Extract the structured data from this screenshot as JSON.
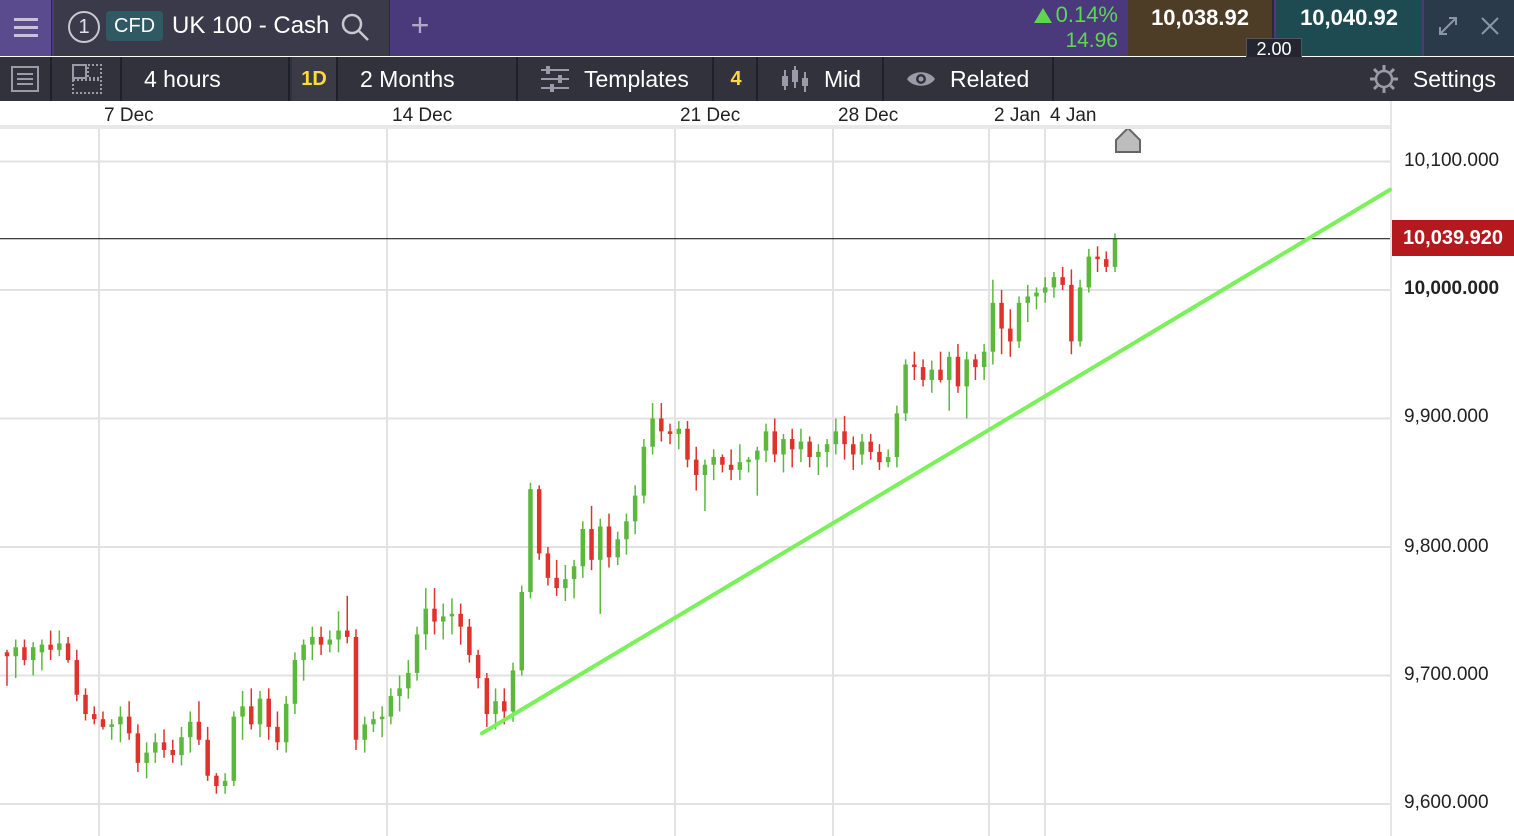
{
  "topbar": {
    "instrument_number": "1",
    "instrument_type": "CFD",
    "instrument_name": "UK 100 - Cash",
    "change_pct": "0.14%",
    "change_abs": "14.96",
    "sell_price": "10,038.92",
    "buy_price": "10,040.92",
    "spread": "2.00",
    "icons": [
      "menu-icon",
      "search-icon",
      "plus-icon",
      "triangle-up-icon",
      "expand-icon",
      "close-icon"
    ]
  },
  "toolbar": {
    "interval": "4 hours",
    "interval_badge": "1D",
    "range": "2 Months",
    "templates": "Templates",
    "templates_count": "4",
    "price_mode": "Mid",
    "related": "Related",
    "settings": "Settings",
    "icons": [
      "list-icon",
      "layout-icon",
      "sliders-icon",
      "candlestick-icon",
      "eye-icon",
      "gear-icon"
    ]
  },
  "chart": {
    "current_price": "10,039.920",
    "date_labels": [
      "7 Dec",
      "14 Dec",
      "21 Dec",
      "28 Dec",
      "2 Jan",
      "4 Jan"
    ],
    "price_labels": [
      "10,100.000",
      "10,000.000",
      "9,900.000",
      "9,800.000",
      "9,700.000",
      "9,600.000"
    ],
    "colors": {
      "up": "#5cb83c",
      "down": "#e0322c",
      "trendline": "#7af05a",
      "current_tag": "#b3191d"
    }
  },
  "chart_data": {
    "type": "candlestick",
    "ylim": [
      9580,
      10140
    ],
    "date_labels": [
      "7 Dec",
      "14 Dec",
      "21 Dec",
      "28 Dec",
      "2 Jan",
      "4 Jan"
    ],
    "y_ticks": [
      10100,
      10000,
      9900,
      9800,
      9700,
      9600
    ],
    "current_price": 10039.92,
    "trendline": {
      "from": 9655,
      "to": 10078
    },
    "candles": [
      [
        9718,
        9720,
        9692,
        9715
      ],
      [
        9715,
        9728,
        9698,
        9722
      ],
      [
        9722,
        9728,
        9708,
        9712
      ],
      [
        9712,
        9726,
        9700,
        9722
      ],
      [
        9718,
        9728,
        9704,
        9724
      ],
      [
        9724,
        9735,
        9712,
        9720
      ],
      [
        9720,
        9735,
        9715,
        9725
      ],
      [
        9725,
        9730,
        9710,
        9712
      ],
      [
        9712,
        9720,
        9680,
        9685
      ],
      [
        9685,
        9690,
        9665,
        9670
      ],
      [
        9670,
        9676,
        9662,
        9666
      ],
      [
        9666,
        9672,
        9658,
        9660
      ],
      [
        9660,
        9666,
        9650,
        9662
      ],
      [
        9662,
        9676,
        9648,
        9668
      ],
      [
        9668,
        9680,
        9650,
        9655
      ],
      [
        9655,
        9662,
        9625,
        9632
      ],
      [
        9632,
        9648,
        9620,
        9640
      ],
      [
        9640,
        9655,
        9632,
        9648
      ],
      [
        9648,
        9658,
        9636,
        9642
      ],
      [
        9642,
        9650,
        9632,
        9638
      ],
      [
        9638,
        9660,
        9630,
        9652
      ],
      [
        9652,
        9672,
        9640,
        9664
      ],
      [
        9664,
        9680,
        9646,
        9650
      ],
      [
        9650,
        9660,
        9618,
        9622
      ],
      [
        9622,
        9624,
        9608,
        9614
      ],
      [
        9614,
        9624,
        9608,
        9618
      ],
      [
        9618,
        9672,
        9614,
        9668
      ],
      [
        9668,
        9688,
        9650,
        9676
      ],
      [
        9676,
        9690,
        9658,
        9662
      ],
      [
        9662,
        9688,
        9652,
        9682
      ],
      [
        9682,
        9690,
        9650,
        9660
      ],
      [
        9660,
        9672,
        9642,
        9648
      ],
      [
        9648,
        9684,
        9640,
        9678
      ],
      [
        9678,
        9718,
        9670,
        9712
      ],
      [
        9712,
        9728,
        9696,
        9724
      ],
      [
        9724,
        9738,
        9712,
        9730
      ],
      [
        9730,
        9738,
        9716,
        9724
      ],
      [
        9724,
        9735,
        9718,
        9728
      ],
      [
        9728,
        9750,
        9718,
        9735
      ],
      [
        9735,
        9762,
        9725,
        9730
      ],
      [
        9730,
        9736,
        9642,
        9650
      ],
      [
        9650,
        9668,
        9640,
        9662
      ],
      [
        9662,
        9672,
        9656,
        9666
      ],
      [
        9666,
        9676,
        9652,
        9668
      ],
      [
        9668,
        9690,
        9662,
        9684
      ],
      [
        9684,
        9700,
        9672,
        9690
      ],
      [
        9690,
        9712,
        9682,
        9702
      ],
      [
        9702,
        9738,
        9696,
        9732
      ],
      [
        9732,
        9768,
        9720,
        9752
      ],
      [
        9752,
        9768,
        9732,
        9742
      ],
      [
        9742,
        9756,
        9728,
        9746
      ],
      [
        9746,
        9760,
        9732,
        9748
      ],
      [
        9748,
        9756,
        9724,
        9738
      ],
      [
        9738,
        9744,
        9710,
        9716
      ],
      [
        9716,
        9720,
        9690,
        9698
      ],
      [
        9698,
        9702,
        9660,
        9670
      ],
      [
        9670,
        9690,
        9658,
        9680
      ],
      [
        9680,
        9690,
        9662,
        9672
      ],
      [
        9672,
        9710,
        9664,
        9704
      ],
      [
        9704,
        9770,
        9700,
        9765
      ],
      [
        9765,
        9850,
        9760,
        9845
      ],
      [
        9845,
        9848,
        9790,
        9795
      ],
      [
        9795,
        9800,
        9770,
        9776
      ],
      [
        9776,
        9790,
        9762,
        9768
      ],
      [
        9768,
        9786,
        9758,
        9775
      ],
      [
        9775,
        9790,
        9760,
        9785
      ],
      [
        9785,
        9820,
        9776,
        9814
      ],
      [
        9814,
        9832,
        9782,
        9790
      ],
      [
        9790,
        9822,
        9748,
        9816
      ],
      [
        9816,
        9826,
        9784,
        9792
      ],
      [
        9792,
        9812,
        9786,
        9806
      ],
      [
        9806,
        9826,
        9794,
        9820
      ],
      [
        9820,
        9848,
        9810,
        9840
      ],
      [
        9840,
        9884,
        9834,
        9878
      ],
      [
        9878,
        9912,
        9872,
        9900
      ],
      [
        9900,
        9912,
        9882,
        9890
      ],
      [
        9890,
        9896,
        9880,
        9888
      ],
      [
        9888,
        9898,
        9876,
        9892
      ],
      [
        9892,
        9898,
        9862,
        9868
      ],
      [
        9868,
        9878,
        9844,
        9856
      ],
      [
        9856,
        9868,
        9828,
        9864
      ],
      [
        9864,
        9876,
        9852,
        9870
      ],
      [
        9870,
        9872,
        9858,
        9864
      ],
      [
        9864,
        9876,
        9852,
        9860
      ],
      [
        9860,
        9880,
        9852,
        9866
      ],
      [
        9866,
        9870,
        9858,
        9868
      ],
      [
        9868,
        9878,
        9840,
        9875
      ],
      [
        9875,
        9896,
        9866,
        9890
      ],
      [
        9890,
        9900,
        9866,
        9872
      ],
      [
        9872,
        9888,
        9858,
        9884
      ],
      [
        9884,
        9892,
        9862,
        9876
      ],
      [
        9876,
        9892,
        9866,
        9882
      ],
      [
        9882,
        9886,
        9862,
        9870
      ],
      [
        9870,
        9880,
        9856,
        9874
      ],
      [
        9874,
        9884,
        9862,
        9880
      ],
      [
        9880,
        9900,
        9872,
        9890
      ],
      [
        9890,
        9902,
        9868,
        9880
      ],
      [
        9880,
        9886,
        9860,
        9872
      ],
      [
        9872,
        9888,
        9864,
        9882
      ],
      [
        9882,
        9888,
        9868,
        9874
      ],
      [
        9874,
        9880,
        9860,
        9866
      ],
      [
        9866,
        9876,
        9862,
        9870
      ],
      [
        9870,
        9910,
        9862,
        9904
      ],
      [
        9904,
        9946,
        9898,
        9942
      ],
      [
        9942,
        9952,
        9930,
        9940
      ],
      [
        9940,
        9946,
        9925,
        9930
      ],
      [
        9930,
        9945,
        9920,
        9938
      ],
      [
        9938,
        9952,
        9928,
        9930
      ],
      [
        9930,
        9952,
        9906,
        9948
      ],
      [
        9948,
        9958,
        9920,
        9925
      ],
      [
        9925,
        9952,
        9900,
        9946
      ],
      [
        9946,
        9950,
        9930,
        9940
      ],
      [
        9940,
        9958,
        9930,
        9952
      ],
      [
        9952,
        10008,
        9942,
        9990
      ],
      [
        9990,
        10000,
        9950,
        9970
      ],
      [
        9970,
        9985,
        9948,
        9960
      ],
      [
        9960,
        9995,
        9955,
        9990
      ],
      [
        9990,
        10004,
        9975,
        9995
      ],
      [
        9995,
        10002,
        9985,
        9998
      ],
      [
        9998,
        10010,
        9990,
        10002
      ],
      [
        10002,
        10014,
        9994,
        10010
      ],
      [
        10010,
        10018,
        10000,
        10004
      ],
      [
        10004,
        10016,
        9950,
        9960
      ],
      [
        9960,
        10008,
        9956,
        10002
      ],
      [
        10002,
        10032,
        9998,
        10026
      ],
      [
        10026,
        10034,
        10014,
        10024
      ],
      [
        10024,
        10030,
        10014,
        10018
      ],
      [
        10018,
        10044,
        10014,
        10040
      ]
    ]
  }
}
